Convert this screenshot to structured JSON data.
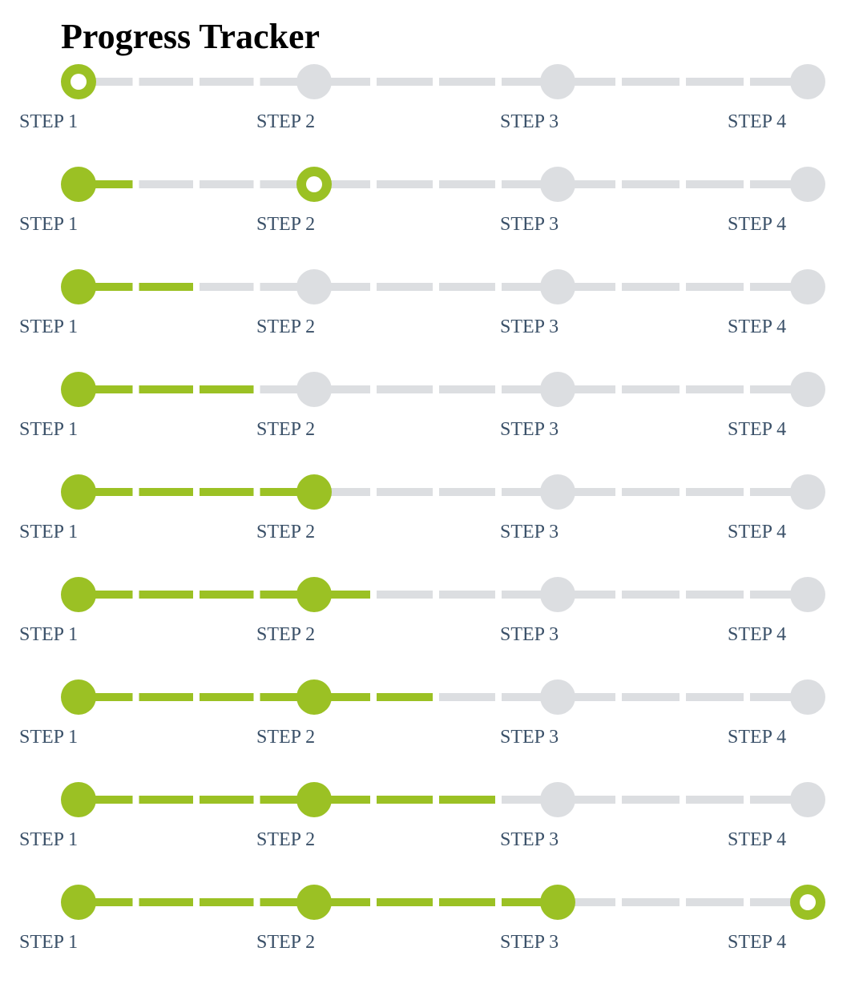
{
  "page": {
    "title": "Progress Tracker"
  },
  "colors": {
    "complete": "#9bc124",
    "incomplete": "#dcdee1",
    "label": "#3a5068",
    "current_center": "#ffffff"
  },
  "step_labels": [
    "STEP 1",
    "STEP 2",
    "STEP 3",
    "STEP 4"
  ],
  "segments_per_gap": 4,
  "trackers": [
    {
      "progress": 0.0,
      "current_step": 1
    },
    {
      "progress": 0.25,
      "current_step": 2
    },
    {
      "progress": 0.5,
      "current_step": null
    },
    {
      "progress": 0.75,
      "current_step": null
    },
    {
      "progress": 1.0,
      "current_step": null
    },
    {
      "progress": 1.25,
      "current_step": null
    },
    {
      "progress": 1.5,
      "current_step": null
    },
    {
      "progress": 1.75,
      "current_step": null
    },
    {
      "progress": 2.0,
      "current_step": 4
    }
  ]
}
